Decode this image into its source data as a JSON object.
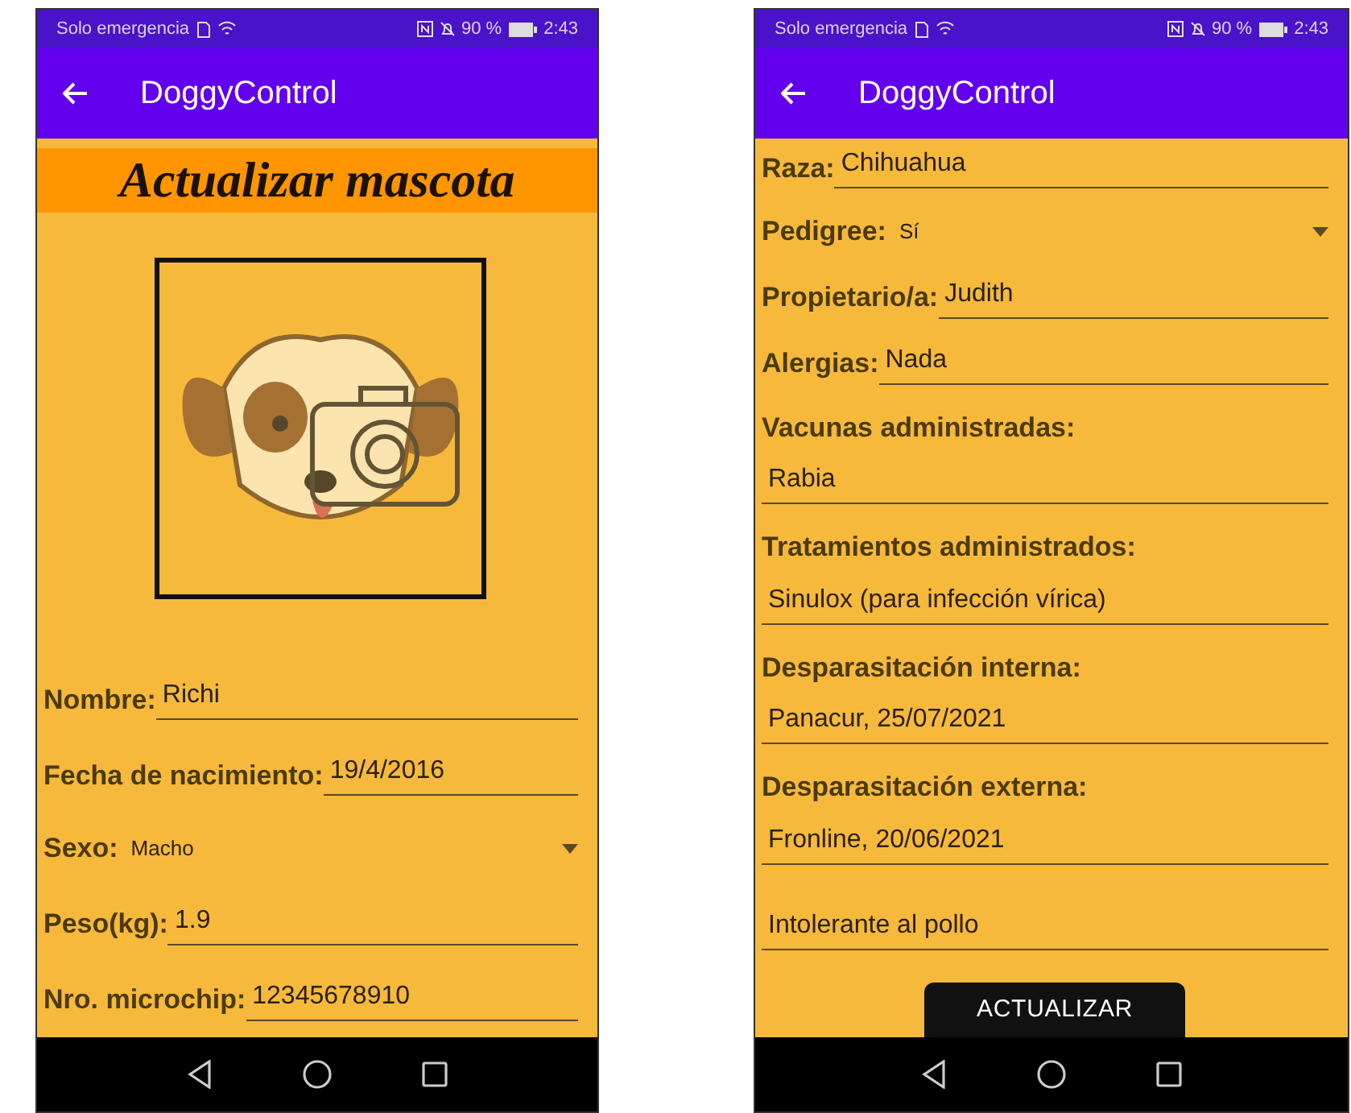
{
  "phones": [
    {
      "status_bar": {
        "carrier": "Solo emergencia",
        "battery": "90 %",
        "time": "2:43"
      },
      "app_bar": {
        "title": "DoggyControl"
      },
      "header": "Actualizar mascota",
      "photo_frame": true,
      "fields": [
        {
          "kind": "inline",
          "label": "Nombre:",
          "value": "Richi"
        },
        {
          "kind": "inline",
          "label": "Fecha de nacimiento:",
          "value": "19/4/2016"
        },
        {
          "kind": "dropdown",
          "label": "Sexo:",
          "value": "Macho"
        },
        {
          "kind": "inline",
          "label": "Peso(kg):",
          "value": "1.9"
        },
        {
          "kind": "inline",
          "label": "Nro. microchip:",
          "value": "12345678910"
        }
      ]
    },
    {
      "status_bar": {
        "carrier": "Solo emergencia",
        "battery": "90 %",
        "time": "2:43"
      },
      "app_bar": {
        "title": "DoggyControl"
      },
      "fields": [
        {
          "kind": "inline",
          "label": "Raza:",
          "value": "Chihuahua"
        },
        {
          "kind": "dropdown",
          "label": "Pedigree:",
          "value": "Sí"
        },
        {
          "kind": "inline",
          "label": "Propietario/a:",
          "value": "Judith"
        },
        {
          "kind": "inline",
          "label": "Alergias:",
          "value": "Nada"
        },
        {
          "kind": "stacked",
          "label": "Vacunas administradas:",
          "value": "Rabia"
        },
        {
          "kind": "stacked",
          "label": "Tratamientos administrados:",
          "value": "Sinulox (para infección vírica)"
        },
        {
          "kind": "stacked",
          "label": "Desparasitación interna:",
          "value": "Panacur, 25/07/2021"
        },
        {
          "kind": "stacked",
          "label": "Desparasitación externa:",
          "value": "Fronline, 20/06/2021"
        },
        {
          "kind": "plain",
          "value": "Intolerante al pollo"
        }
      ],
      "button": "ACTUALIZAR"
    }
  ]
}
